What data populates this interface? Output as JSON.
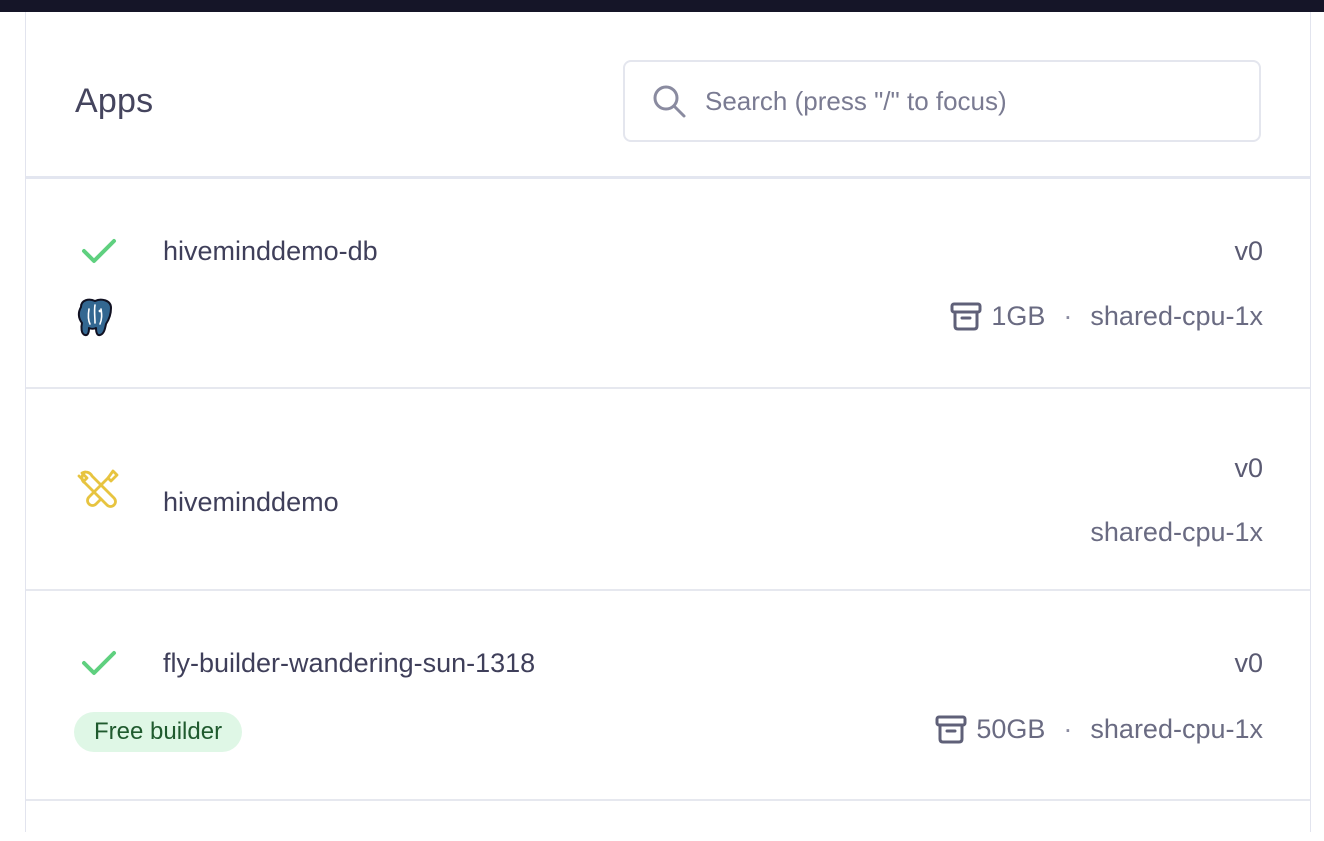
{
  "header": {
    "title": "Apps",
    "search_placeholder": "Search (press \"/\" to focus)",
    "search_value": ""
  },
  "icons": {
    "search": "search-icon",
    "deployed": "check-icon",
    "pending": "tools-icon",
    "postgres": "postgres-elephant-icon",
    "volume": "archive-box-icon"
  },
  "colors": {
    "check": "#5fd07f",
    "tools": "#e7c440",
    "badge_bg": "#dff7e6",
    "badge_text": "#1f5a2e",
    "topbar": "#151528"
  },
  "apps": [
    {
      "name": "hiveminddemo-db",
      "status": "deployed",
      "version": "v0",
      "volume": "1GB",
      "separator": "·",
      "machine": "shared-cpu-1x",
      "platform": "postgres"
    },
    {
      "name": "hiveminddemo",
      "status": "pending",
      "version": "v0",
      "machine": "shared-cpu-1x"
    },
    {
      "name": "fly-builder-wandering-sun-1318",
      "status": "deployed",
      "version": "v0",
      "volume": "50GB",
      "separator": "·",
      "machine": "shared-cpu-1x",
      "badge": "Free builder"
    }
  ]
}
